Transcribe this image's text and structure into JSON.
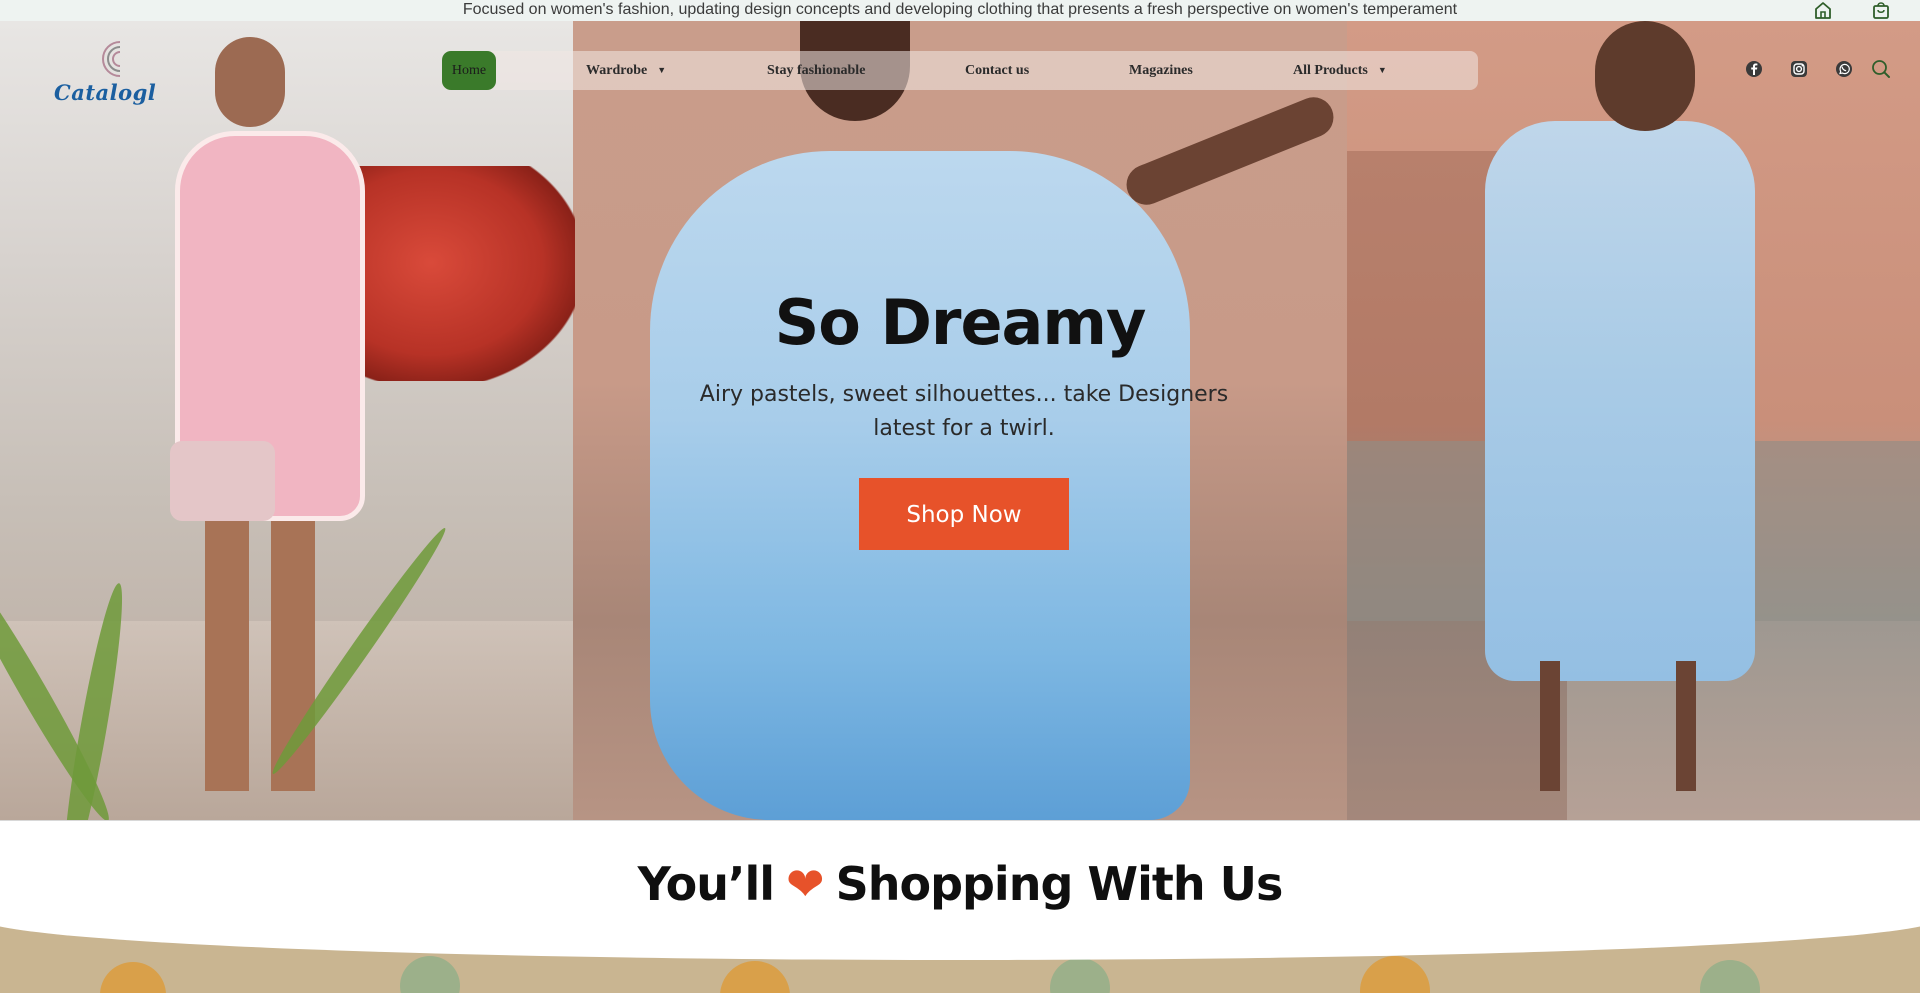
{
  "announcement": {
    "text": "Focused on women's fashion, updating design concepts and developing clothing that presents a fresh perspective on women's temperament",
    "icons": [
      "home-icon",
      "shopping-bag-icon"
    ]
  },
  "brand": {
    "logo_text": "Catalogl"
  },
  "nav": {
    "items": [
      {
        "label": "Home",
        "active": true
      },
      {
        "label": "Wardrobe",
        "dropdown": true
      },
      {
        "label": "Stay fashionable"
      },
      {
        "label": "Contact us"
      },
      {
        "label": "Magazines"
      },
      {
        "label": "All Products",
        "dropdown": true
      }
    ],
    "caret": "▼"
  },
  "social": [
    "facebook-icon",
    "instagram-icon",
    "whatsapp-icon",
    "search-icon"
  ],
  "hero": {
    "title": "So Dreamy",
    "subtitle": "Airy pastels, sweet silhouettes... take  Designers latest for a twirl.",
    "cta": "Shop Now"
  },
  "section": {
    "title_before": "You’ll",
    "heart": "❤",
    "title_after": "Shopping With Us"
  },
  "colors": {
    "accent": "#e7522a",
    "nav_active": "#3a7a2a",
    "logo": "#1b5fa0"
  }
}
